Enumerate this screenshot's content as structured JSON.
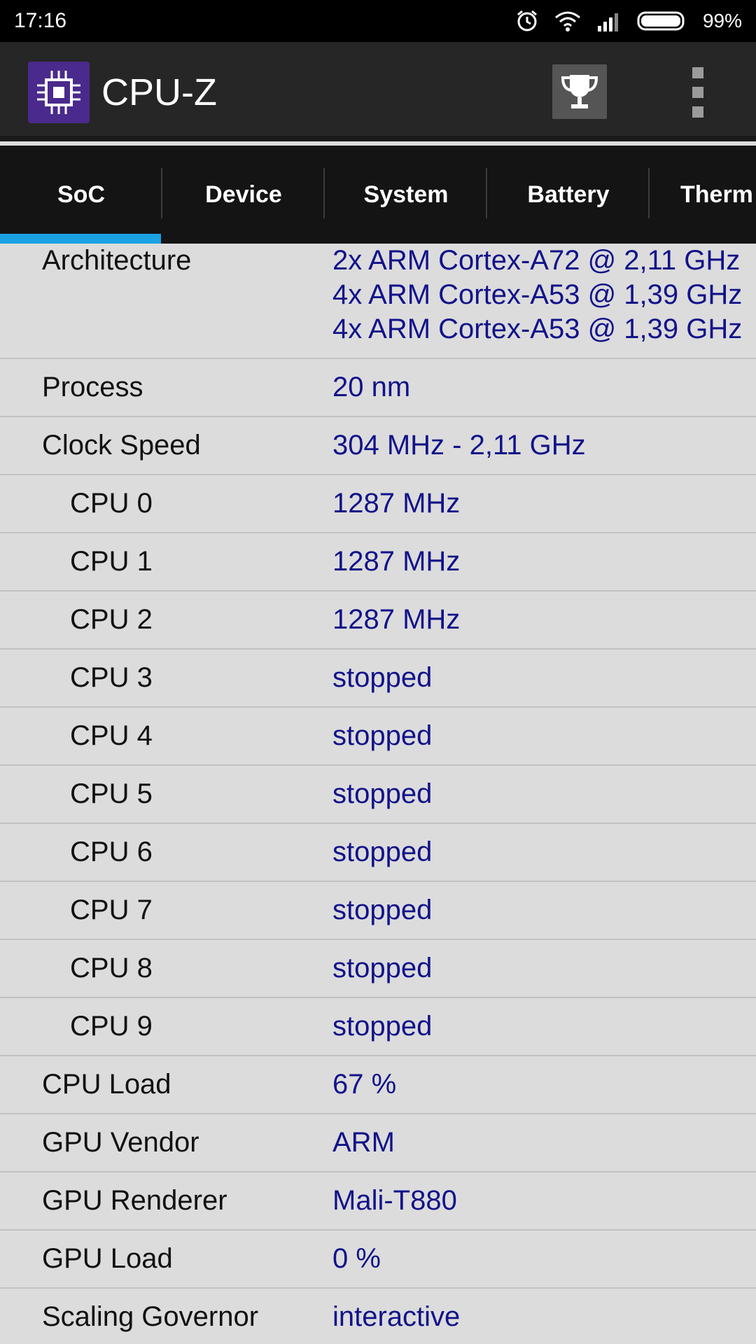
{
  "status_bar": {
    "time": "17:16",
    "icons": [
      "alarm-icon",
      "wifi-icon",
      "signal-icon",
      "battery-icon"
    ],
    "battery": "99%"
  },
  "app_bar": {
    "title": "CPU-Z",
    "logo_icon": "cpu-chip-icon",
    "trophy_icon": "trophy-icon",
    "menu_icon": "overflow-menu-icon"
  },
  "tabs": [
    {
      "label": "SoC",
      "active": true
    },
    {
      "label": "Device",
      "active": false
    },
    {
      "label": "System",
      "active": false
    },
    {
      "label": "Battery",
      "active": false
    },
    {
      "label": "Therm",
      "active": false
    }
  ],
  "colors": {
    "accent": "#1ba1e2",
    "value_text": "#12128a",
    "background": "#dcdcdc"
  },
  "rows": [
    {
      "label": "Architecture",
      "values": [
        "2x ARM Cortex-A72 @ 2,11 GHz",
        "4x ARM Cortex-A53 @ 1,39 GHz",
        "4x ARM Cortex-A53 @ 1,39 GHz"
      ],
      "indent": false
    },
    {
      "label": "Process",
      "values": [
        "20 nm"
      ],
      "indent": false
    },
    {
      "label": "Clock Speed",
      "values": [
        "304 MHz - 2,11 GHz"
      ],
      "indent": false
    },
    {
      "label": "CPU 0",
      "values": [
        "1287 MHz"
      ],
      "indent": true
    },
    {
      "label": "CPU 1",
      "values": [
        "1287 MHz"
      ],
      "indent": true
    },
    {
      "label": "CPU 2",
      "values": [
        "1287 MHz"
      ],
      "indent": true
    },
    {
      "label": "CPU 3",
      "values": [
        "stopped"
      ],
      "indent": true
    },
    {
      "label": "CPU 4",
      "values": [
        "stopped"
      ],
      "indent": true
    },
    {
      "label": "CPU 5",
      "values": [
        "stopped"
      ],
      "indent": true
    },
    {
      "label": "CPU 6",
      "values": [
        "stopped"
      ],
      "indent": true
    },
    {
      "label": "CPU 7",
      "values": [
        "stopped"
      ],
      "indent": true
    },
    {
      "label": "CPU 8",
      "values": [
        "stopped"
      ],
      "indent": true
    },
    {
      "label": "CPU 9",
      "values": [
        "stopped"
      ],
      "indent": true
    },
    {
      "label": "CPU Load",
      "values": [
        "67 %"
      ],
      "indent": false
    },
    {
      "label": "GPU Vendor",
      "values": [
        "ARM"
      ],
      "indent": false
    },
    {
      "label": "GPU Renderer",
      "values": [
        "Mali-T880"
      ],
      "indent": false
    },
    {
      "label": "GPU Load",
      "values": [
        "0 %"
      ],
      "indent": false
    },
    {
      "label": "Scaling Governor",
      "values": [
        "interactive"
      ],
      "indent": false
    }
  ]
}
